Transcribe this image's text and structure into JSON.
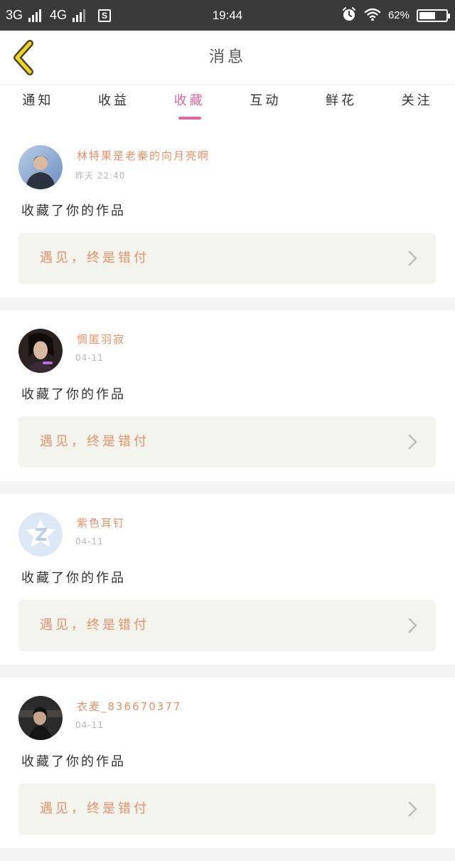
{
  "status_bar": {
    "network1": "3G",
    "network2": "4G",
    "s_icon": "S",
    "time": "19:44",
    "alarm_icon": "alarm-icon",
    "wifi_icon": "wifi-icon",
    "battery_text": "62%",
    "battery_level": 0.62
  },
  "header": {
    "title": "消息",
    "back_icon": "chevron-left-icon"
  },
  "tabs": [
    {
      "label": "通知",
      "active": false
    },
    {
      "label": "收益",
      "active": false
    },
    {
      "label": "收藏",
      "active": true
    },
    {
      "label": "互动",
      "active": false
    },
    {
      "label": "鲜花",
      "active": false
    },
    {
      "label": "关注",
      "active": false
    }
  ],
  "messages": [
    {
      "username": "林特果是老秦的向月亮啊",
      "time": "昨天 22:40",
      "action": "收藏了你的作品",
      "work_title": "遇见，终是错付"
    },
    {
      "username": "惆匿羽寂",
      "time": "04-11",
      "action": "收藏了你的作品",
      "work_title": "遇见，终是错付"
    },
    {
      "username": "紫色耳钉",
      "time": "04-11",
      "action": "收藏了你的作品",
      "work_title": "遇见，终是错付"
    },
    {
      "username": "衣麦_836670377",
      "time": "04-11",
      "action": "收藏了你的作品",
      "work_title": "遇见，终是错付"
    }
  ],
  "colors": {
    "accent": "#e0679c",
    "username": "#e8916a",
    "work_bg": "#f4f4ee",
    "status_bar": "#3a3a3a",
    "back_chevron": "#f2d22e"
  }
}
